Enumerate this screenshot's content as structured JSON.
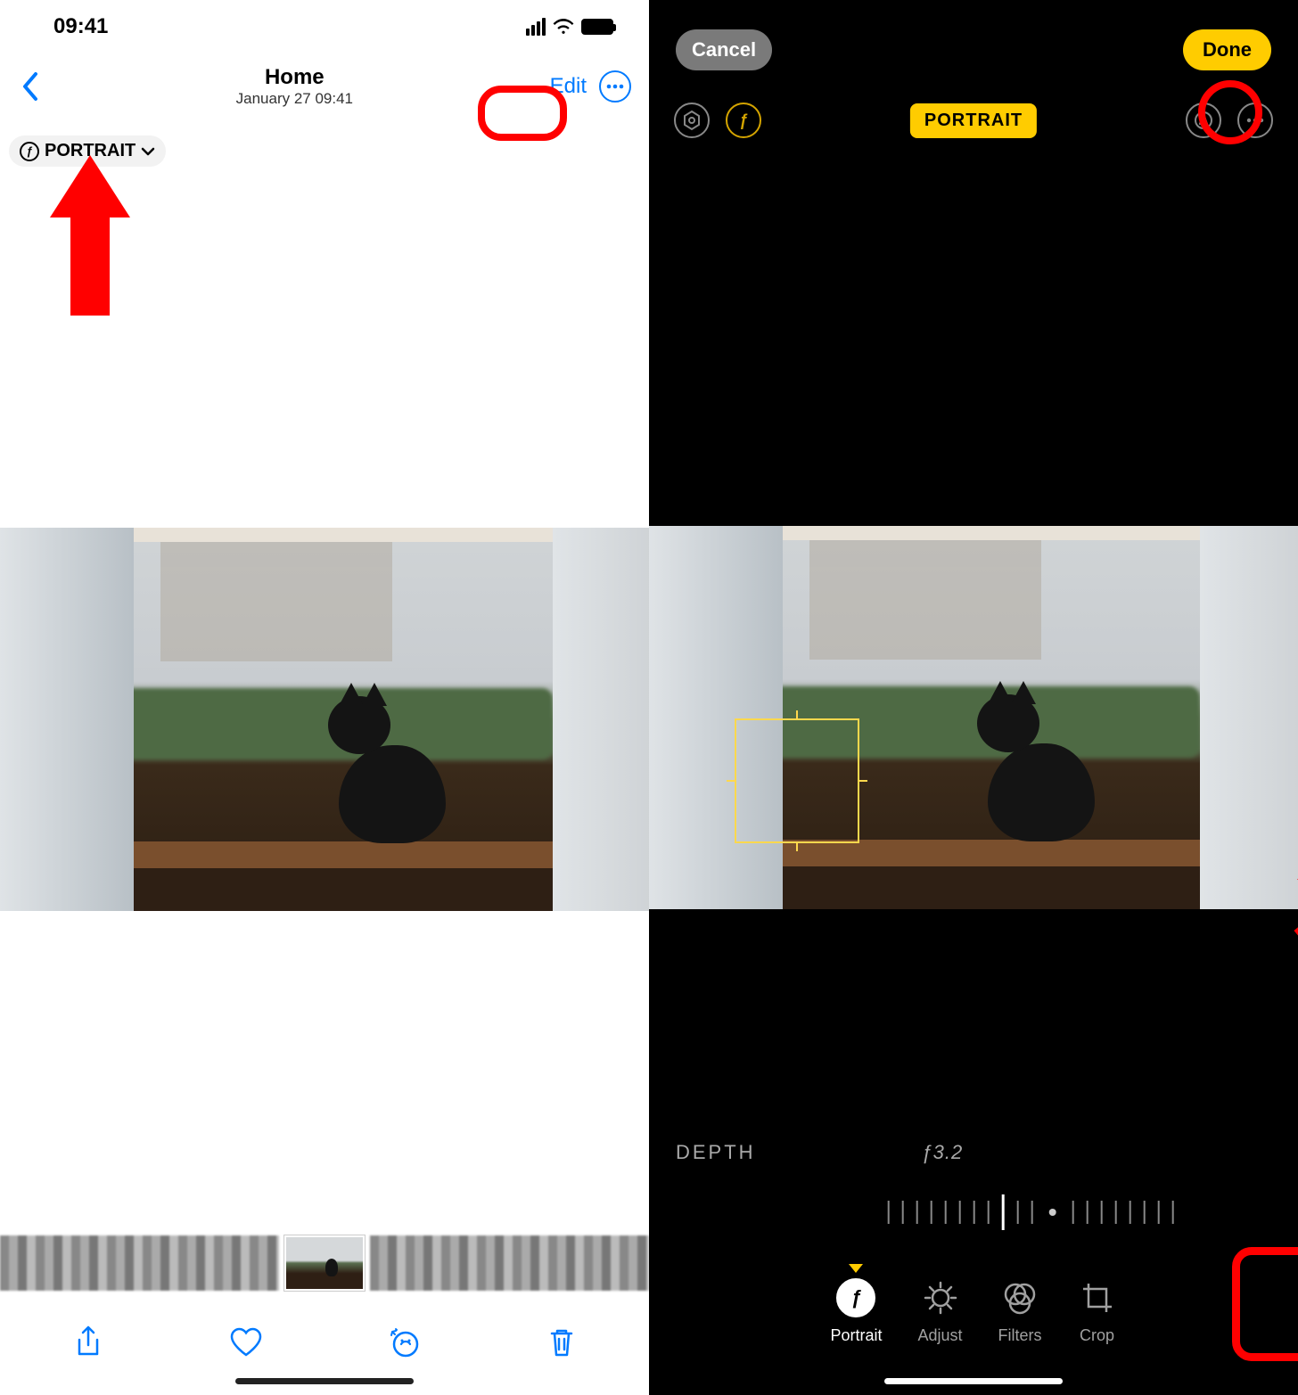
{
  "left": {
    "status": {
      "time": "09:41"
    },
    "nav": {
      "title": "Home",
      "subtitle": "January 27  09:41",
      "edit": "Edit"
    },
    "portrait_chip": "PORTRAIT"
  },
  "right": {
    "top": {
      "cancel": "Cancel",
      "done": "Done"
    },
    "portrait_label": "PORTRAIT",
    "depth": {
      "label": "DEPTH",
      "value": "ƒ3.2"
    },
    "modes": {
      "portrait": "Portrait",
      "adjust": "Adjust",
      "filters": "Filters",
      "crop": "Crop"
    }
  }
}
